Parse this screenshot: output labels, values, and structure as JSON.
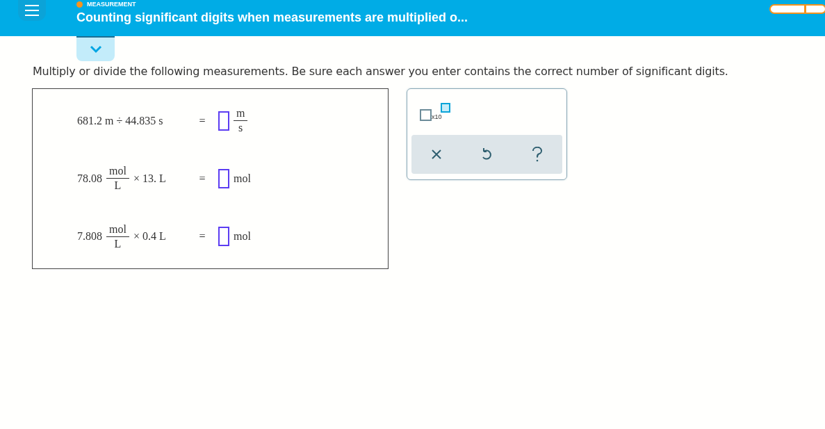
{
  "header": {
    "topic": "MEASUREMENT",
    "title": "Counting significant digits when measurements are multiplied o..."
  },
  "instructions": "Multiply or divide the following measurements. Be sure each answer you enter contains the correct number of significant digits.",
  "problems": [
    {
      "lhs": [
        {
          "kind": "text",
          "text": "681.2 m ÷ 44.835 s"
        }
      ],
      "equals": "=",
      "unit": {
        "kind": "fraction",
        "numerator": "m",
        "denominator": "s"
      }
    },
    {
      "lhs": [
        {
          "kind": "text",
          "text": "78.08"
        },
        {
          "kind": "fraction",
          "numerator": "mol",
          "denominator": "L"
        },
        {
          "kind": "text",
          "text": "× 13. L"
        }
      ],
      "equals": "=",
      "unit": {
        "kind": "text",
        "text": "mol"
      }
    },
    {
      "lhs": [
        {
          "kind": "text",
          "text": "7.808"
        },
        {
          "kind": "fraction",
          "numerator": "mol",
          "denominator": "L"
        },
        {
          "kind": "text",
          "text": "× 0.4 L"
        }
      ],
      "equals": "=",
      "unit": {
        "kind": "text",
        "text": "mol"
      }
    }
  ],
  "toolbox": {
    "exponent_label": "x10"
  }
}
